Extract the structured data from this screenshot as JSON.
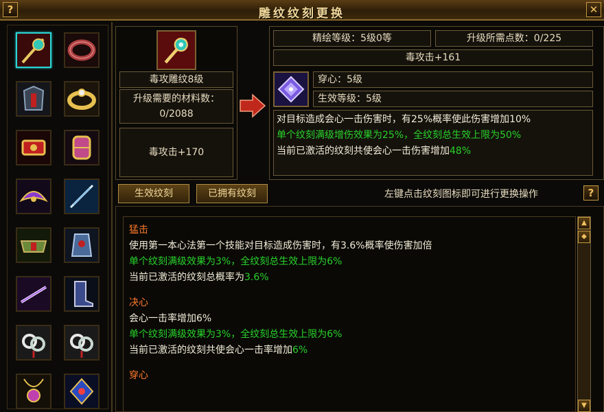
{
  "window": {
    "title": "雕纹纹刻更换",
    "help_glyph": "?",
    "close_glyph": "✕"
  },
  "left_icons": [
    {
      "icon": "jade-staff-icon",
      "selected": true
    },
    {
      "icon": "red-bracelet-icon",
      "selected": false
    },
    {
      "icon": "dark-armor-icon",
      "selected": false
    },
    {
      "icon": "gold-ring-icon",
      "selected": false
    },
    {
      "icon": "red-belt-icon",
      "selected": false
    },
    {
      "icon": "gold-bracer-icon",
      "selected": false
    },
    {
      "icon": "purple-crest-icon",
      "selected": false
    },
    {
      "icon": "blue-blade-icon",
      "selected": false
    },
    {
      "icon": "green-waist-icon",
      "selected": false
    },
    {
      "icon": "blue-gauntlet-icon",
      "selected": false
    },
    {
      "icon": "violet-sword-icon",
      "selected": false
    },
    {
      "icon": "blue-boots-icon",
      "selected": false
    },
    {
      "icon": "jade-charm-icon",
      "selected": false
    },
    {
      "icon": "jade-charm-icon",
      "selected": false
    },
    {
      "icon": "amethyst-necklace-icon",
      "selected": false
    },
    {
      "icon": "blue-amulet-icon",
      "selected": false
    }
  ],
  "current": {
    "name": "毒攻雕纹8级",
    "material_label": "升级需要的材料数：",
    "material_value": "0/2088",
    "stat": "毒攻击+170"
  },
  "upgrade": {
    "refine_level": "精绘等级：5级0等",
    "points_needed": "升级所需点数：0/225",
    "stat": "毒攻击+161",
    "engrave_name": "穿心：5级",
    "effective_level": "生效等级：5级",
    "desc1": "对目标造成会心一击伤害时，有25%概率使此伤害增加10%",
    "desc2": "单个纹刻满级增伤效果为25%，全纹刻总生效上限为50%",
    "desc3_prefix": "当前已激活的纹刻共使会心一击伤害增加",
    "desc3_value": "48%"
  },
  "tabs": {
    "active": "生效纹刻",
    "owned": "已拥有纹刻"
  },
  "hint": "左键点击纹刻图标即可进行更换操作",
  "hint_icon": "?",
  "entries": [
    {
      "title": "猛击",
      "desc": "使用第一本心法第一个技能对目标造成伤害时，有3.6%概率使伤害加倍",
      "line": "单个纹刻满级效果为3%，全纹刻总生效上限为6%",
      "cur_prefix": "当前已激活的纹刻总概率为",
      "cur_value": "3.6%"
    },
    {
      "title": "决心",
      "desc": "会心一击率增加6%",
      "line": "单个纹刻满级效果为3%，全纹刻总生效上限为6%",
      "cur_prefix": "当前已激活的纹刻共使会心一击率增加",
      "cur_value": "6%"
    },
    {
      "title": "穿心",
      "desc": "",
      "line": "",
      "cur_prefix": "",
      "cur_value": ""
    }
  ],
  "scrollbar": {
    "up": "▲",
    "thumb": "◆",
    "down": "▼",
    "label": ""
  },
  "colors": {
    "accent": "#f2d89a",
    "orange": "#ff7a2a",
    "green": "#28d22a",
    "cyan_select": "#2ad6d6"
  }
}
